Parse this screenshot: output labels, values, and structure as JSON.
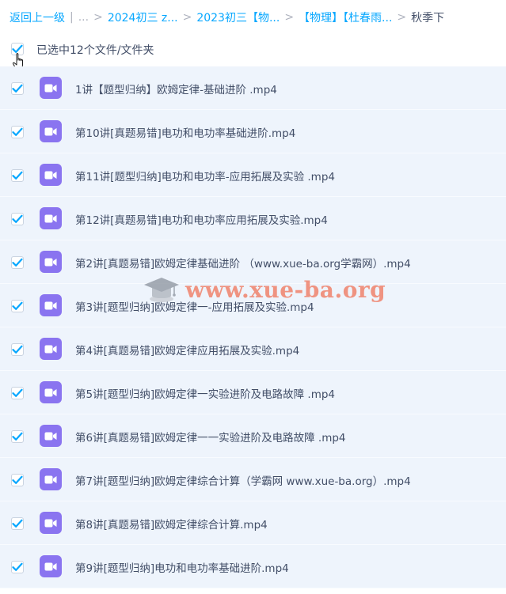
{
  "breadcrumb": {
    "back_label": "返回上一级",
    "separator": "|",
    "ellipsis": "...",
    "chevron": ">",
    "items": [
      "2024初三 z...",
      "2023初三【物...",
      "【物理】【杜春雨..."
    ],
    "current": "秋季下"
  },
  "selection": {
    "label": "已选中12个文件/文件夹",
    "checked": true
  },
  "files": [
    {
      "name": "1讲【题型归纳】欧姆定律-基础进阶 .mp4",
      "checked": true,
      "icon": "video-icon"
    },
    {
      "name": "第10讲[真题易错]电功和电功率基础进阶.mp4",
      "checked": true,
      "icon": "video-icon"
    },
    {
      "name": "第11讲[题型归纳]电功和电功率-应用拓展及实验 .mp4",
      "checked": true,
      "icon": "video-icon"
    },
    {
      "name": "第12讲[真题易错]电功和电功率应用拓展及实验.mp4",
      "checked": true,
      "icon": "video-icon"
    },
    {
      "name": "第2讲[真题易错]欧姆定律基础进阶 （www.xue-ba.org学霸网）.mp4",
      "checked": true,
      "icon": "video-icon"
    },
    {
      "name": "第3讲[题型归纳]欧姆定律一-应用拓展及实验.mp4",
      "checked": true,
      "icon": "video-icon"
    },
    {
      "name": "第4讲[真题易错]欧姆定律应用拓展及实验.mp4",
      "checked": true,
      "icon": "video-icon"
    },
    {
      "name": "第5讲[题型归纳]欧姆定律一实验进阶及电路故障 .mp4",
      "checked": true,
      "icon": "video-icon"
    },
    {
      "name": "第6讲[真题易错]欧姆定律一一实验进阶及电路故障 .mp4",
      "checked": true,
      "icon": "video-icon"
    },
    {
      "name": "第7讲[题型归纳]欧姆定律综合计算（学霸网 www.xue-ba.org）.mp4",
      "checked": true,
      "icon": "video-icon"
    },
    {
      "name": "第8讲[真题易错]欧姆定律综合计算.mp4",
      "checked": true,
      "icon": "video-icon"
    },
    {
      "name": "第9讲[题型归纳]电功和电功率基础进阶.mp4",
      "checked": true,
      "icon": "video-icon"
    }
  ],
  "watermark": {
    "text": "www.xue-ba.org"
  },
  "colors": {
    "accent": "#06a7ff",
    "row_background": "#eef4fc",
    "video_icon": "#8a74f0",
    "watermark": "#f0795f"
  }
}
